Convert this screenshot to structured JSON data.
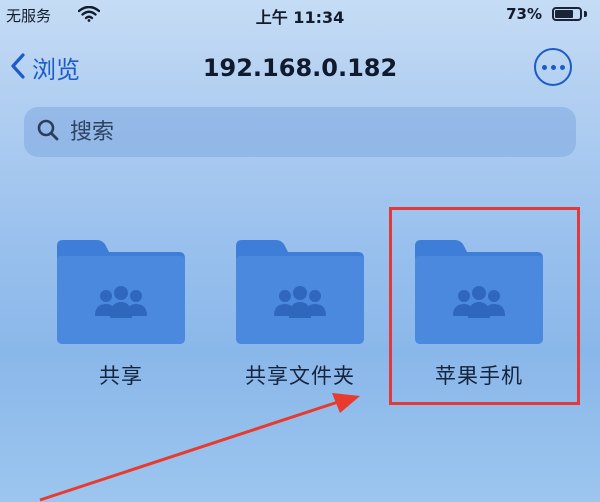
{
  "status_bar": {
    "carrier": "无服务",
    "time": "上午 11:34",
    "battery_percent": "73%",
    "battery_level": 0.73
  },
  "nav": {
    "back_label": "浏览",
    "title": "192.168.0.182"
  },
  "search": {
    "placeholder": "搜索"
  },
  "folders": [
    {
      "label": "共享"
    },
    {
      "label": "共享文件夹"
    },
    {
      "label": "苹果手机"
    }
  ],
  "colors": {
    "accent": "#1c5cc8",
    "folder": "#3f7ed8",
    "highlight": "#e03a3a"
  }
}
